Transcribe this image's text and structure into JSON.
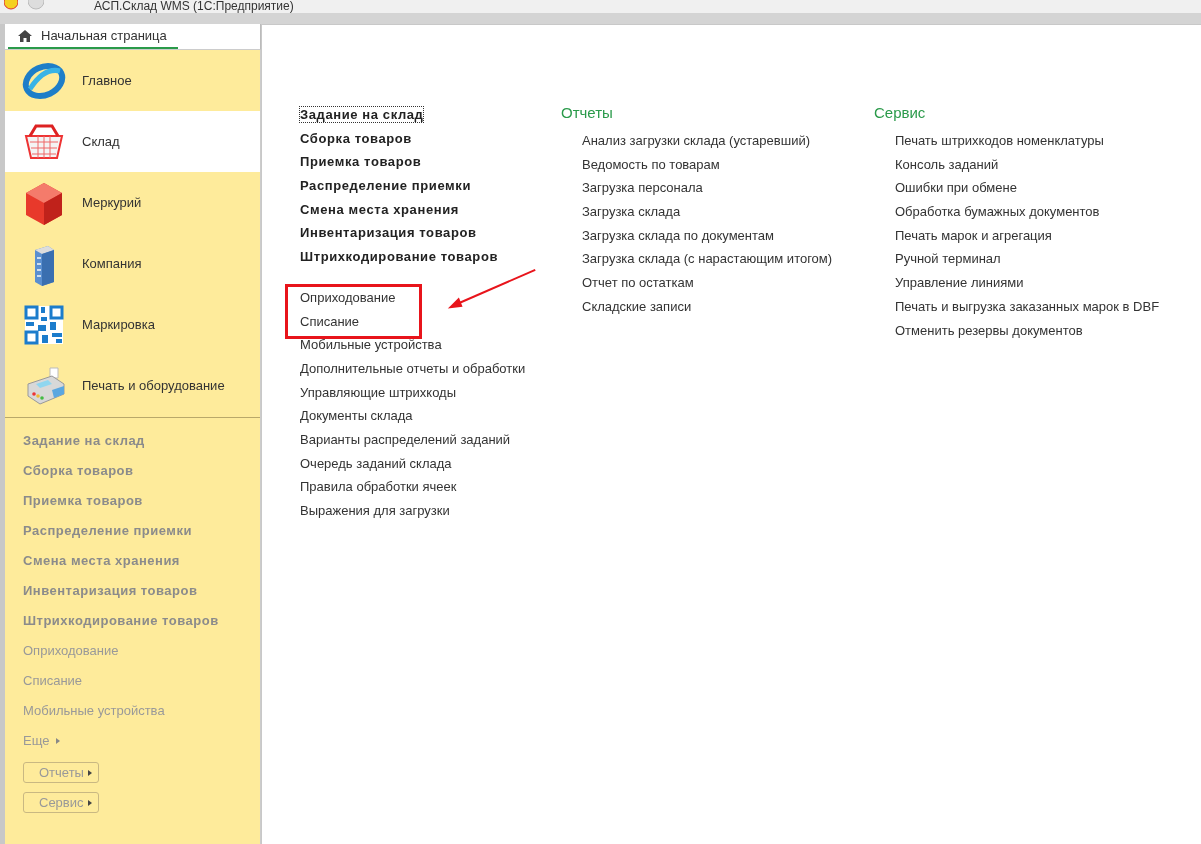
{
  "window": {
    "title": "АСП.Склад WMS  (1С:Предприятие)"
  },
  "tabs": [
    {
      "label": "Начальная страница",
      "selected": true
    }
  ],
  "sections": [
    {
      "label": "Главное",
      "selected": false
    },
    {
      "label": "Склад",
      "selected": true
    },
    {
      "label": "Меркурий",
      "selected": false
    },
    {
      "label": "Компания",
      "selected": false
    },
    {
      "label": "Маркировка",
      "selected": false
    },
    {
      "label": "Печать и оборудование",
      "selected": false
    }
  ],
  "sidebar_commands": [
    {
      "label": "Задание на склад",
      "kind": "important"
    },
    {
      "label": "Сборка товаров",
      "kind": "important"
    },
    {
      "label": "Приемка товаров",
      "kind": "important"
    },
    {
      "label": "Распределение приемки",
      "kind": "important"
    },
    {
      "label": "Смена места хранения",
      "kind": "important"
    },
    {
      "label": "Инвентаризация товаров",
      "kind": "important"
    },
    {
      "label": "Штрихкодирование товаров",
      "kind": "important"
    },
    {
      "label": "Оприходование",
      "kind": "normal"
    },
    {
      "label": "Списание",
      "kind": "normal"
    },
    {
      "label": "Мобильные устройства",
      "kind": "normal"
    },
    {
      "label": "Еще",
      "kind": "more"
    },
    {
      "label": "Отчеты",
      "kind": "button"
    },
    {
      "label": "Сервис",
      "kind": "button"
    }
  ],
  "main": {
    "commands": [
      {
        "label": "Задание на склад",
        "kind": "important",
        "focused": true
      },
      {
        "label": "Сборка товаров",
        "kind": "important",
        "focused": false
      },
      {
        "label": "Приемка товаров",
        "kind": "important",
        "focused": false
      },
      {
        "label": "Распределение приемки",
        "kind": "important",
        "focused": false
      },
      {
        "label": "Смена места хранения",
        "kind": "important",
        "focused": false
      },
      {
        "label": "Инвентаризация товаров",
        "kind": "important",
        "focused": false
      },
      {
        "label": "Штрихкодирование товаров",
        "kind": "important",
        "focused": false
      },
      {
        "label": "Оприходование",
        "kind": "normal",
        "focused": false,
        "highlighted": true
      },
      {
        "label": "Списание",
        "kind": "normal",
        "focused": false,
        "highlighted": true
      },
      {
        "label": "Мобильные устройства",
        "kind": "normal",
        "focused": false
      },
      {
        "label": "Дополнительные отчеты и обработки",
        "kind": "normal",
        "focused": false
      },
      {
        "label": "Управляющие штрихкоды",
        "kind": "normal",
        "focused": false
      },
      {
        "label": "Документы склада",
        "kind": "normal",
        "focused": false
      },
      {
        "label": "Варианты распределений заданий",
        "kind": "normal",
        "focused": false
      },
      {
        "label": "Очередь заданий склада",
        "kind": "normal",
        "focused": false
      },
      {
        "label": "Правила обработки ячеек",
        "kind": "normal",
        "focused": false
      },
      {
        "label": "Выражения для загрузки",
        "kind": "normal",
        "focused": false
      }
    ],
    "groups": [
      {
        "title": "Отчеты",
        "items": [
          "Анализ загрузки склада (устаревший)",
          "Ведомость по товарам",
          "Загрузка персонала",
          "Загрузка склада",
          "Загрузка склада по документам",
          "Загрузка склада (с нарастающим итогом)",
          "Отчет по остаткам",
          "Складские записи"
        ]
      },
      {
        "title": "Сервис",
        "items": [
          "Печать штрихкодов номенклатуры",
          "Консоль заданий",
          "Ошибки при обмене",
          "Обработка бумажных документов",
          "Печать марок и агрегация",
          "Ручной терминал",
          "Управление линиями",
          "Печать и выгрузка заказанных марок в DBF",
          "Отменить резервы документов"
        ]
      }
    ]
  }
}
